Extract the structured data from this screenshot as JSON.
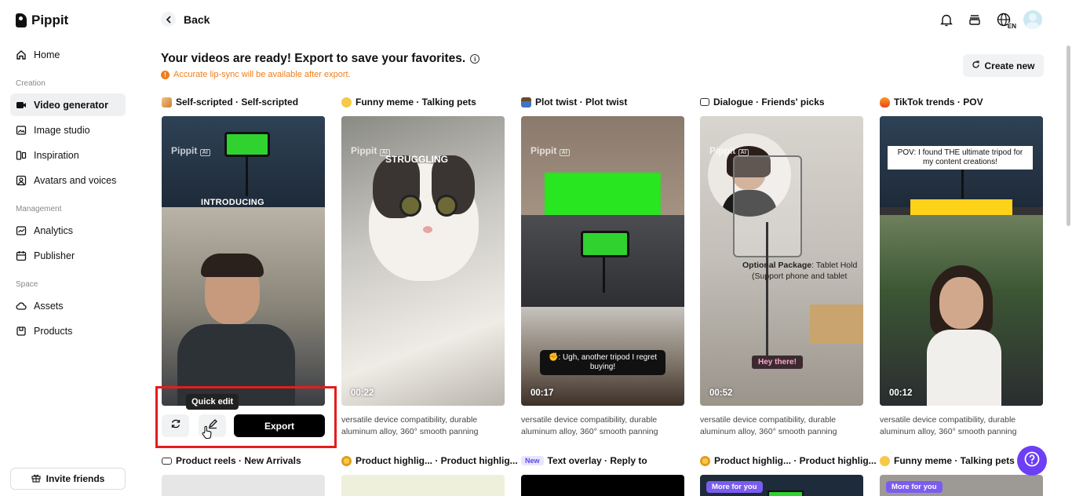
{
  "app": {
    "name": "Pippit"
  },
  "sidebar": {
    "items": [
      {
        "label": "Home"
      },
      {
        "label": "Video generator"
      },
      {
        "label": "Image studio"
      },
      {
        "label": "Inspiration"
      },
      {
        "label": "Avatars and voices"
      },
      {
        "label": "Analytics"
      },
      {
        "label": "Publisher"
      },
      {
        "label": "Assets"
      },
      {
        "label": "Products"
      }
    ],
    "sections": [
      "Creation",
      "Management",
      "Space"
    ],
    "invite_label": "Invite friends"
  },
  "header": {
    "back_label": "Back",
    "lang_badge": "EN"
  },
  "main": {
    "title": "Your videos are ready! Export to save your favorites.",
    "notice": "Accurate lip-sync will be available after export.",
    "create_new_label": "Create new",
    "cards": [
      {
        "title": "Self-scripted · Self-scripted",
        "overlay": "INTRODUCING",
        "desc": "versatile device compatibility, durable aluminum alloy, 360° smooth panning"
      },
      {
        "title": "Funny meme · Talking pets",
        "overlay": "STRUGGLING",
        "duration": "00:22",
        "desc": "versatile device compatibility, durable aluminum alloy, 360° smooth panning"
      },
      {
        "title": "Plot twist · Plot twist",
        "caption": "✊: Ugh, another tripod I regret buying!",
        "duration": "00:17",
        "desc": "versatile device compatibility, durable aluminum alloy, 360° smooth panning"
      },
      {
        "title": "Dialogue · Friends' picks",
        "overlay_bold": "Optional Package",
        "overlay": ": Tablet Hold",
        "overlay2": "(Support phone and tablet",
        "tag": "Hey there!",
        "duration": "00:52",
        "desc": "versatile device compatibility, durable aluminum alloy, 360° smooth panning"
      },
      {
        "title": "TikTok trends · POV",
        "caption": "POV: I found THE ultimate tripod for my content creations!",
        "duration": "00:12",
        "desc": "versatile device compatibility, durable aluminum alloy, 360° smooth panning"
      }
    ],
    "watermark": "Pippit",
    "watermark_badge": "AI",
    "actions": {
      "tooltip": "Quick edit",
      "export_label": "Export"
    },
    "row2": [
      {
        "title": "Product reels · New Arrivals"
      },
      {
        "title": "Product highlig... · Product highlig..."
      },
      {
        "badge": "New",
        "title": "Text overlay · Reply to"
      },
      {
        "title": "Product highlig... · Product highlig...",
        "more": "More for you"
      },
      {
        "title": "Funny meme · Talking pets",
        "more": "More for you"
      }
    ]
  },
  "colors": {
    "accent": "#6c3ff5",
    "warning": "#f07d19",
    "highlight": "#e61c1c"
  }
}
